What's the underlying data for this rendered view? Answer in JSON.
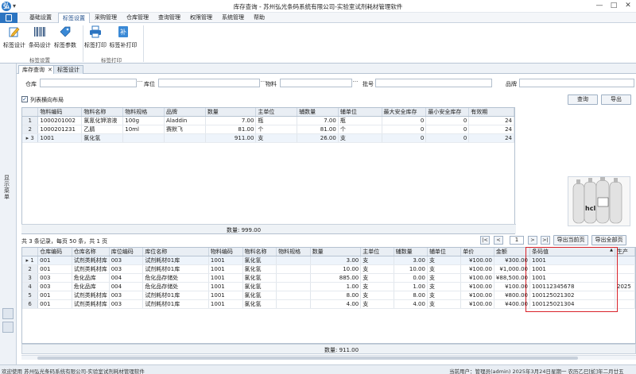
{
  "window": {
    "title": "库存查询 - 苏州弘光条码系统有限公司-实验室试剂耗材管理软件",
    "logo_glyph": "弘",
    "qat_glyph": "▾",
    "min": "—",
    "max": "□",
    "close": "✕"
  },
  "menu": {
    "tabs": [
      {
        "label": "基础设置"
      },
      {
        "label": "标签设置"
      },
      {
        "label": "采购管理"
      },
      {
        "label": "仓库管理"
      },
      {
        "label": "查询管理"
      },
      {
        "label": "权限管理"
      },
      {
        "label": "系统管理"
      },
      {
        "label": "帮助"
      }
    ],
    "active_index": 1
  },
  "ribbon": {
    "groups": [
      {
        "label": "标签设置"
      },
      {
        "label": "标签打印"
      }
    ],
    "buttons": [
      {
        "label": "标签设计",
        "icon": "pencil-edit-icon"
      },
      {
        "label": "条码设计",
        "icon": "barcode-icon"
      },
      {
        "label": "标签参数",
        "icon": "tag-settings-icon"
      },
      {
        "label": "标签打印",
        "icon": "printer-icon"
      },
      {
        "label": "标签补打印",
        "icon": "reprint-icon"
      }
    ]
  },
  "left_panel": {
    "label": "显示菜单"
  },
  "doc_tabs": [
    {
      "label": "库存查询",
      "close": "✕"
    },
    {
      "label": "标签设计"
    }
  ],
  "filters": [
    {
      "label": "仓库",
      "value": ""
    },
    {
      "label": "库位",
      "value": ""
    },
    {
      "label": "物料",
      "value": ""
    },
    {
      "label": "批号",
      "value": ""
    },
    {
      "label": "品牌",
      "value": ""
    }
  ],
  "filter_dots": "···",
  "actions": {
    "checkbox_label": "列表横向布局",
    "checkbox_checked": true,
    "check_mark": "✓",
    "query": "查询",
    "export": "导出"
  },
  "top_grid": {
    "columns": [
      "物料编码",
      "物料名称",
      "物料规格",
      "品牌",
      "数量",
      "主单位",
      "辅数量",
      "辅单位",
      "最大安全库存",
      "最小安全库存",
      "有效期"
    ],
    "current_row_marker": "▸",
    "rows": [
      {
        "idx": "1",
        "cells": [
          "1000201002",
          "氯氰化钾溶液",
          "100g",
          "Aladdin",
          "7.00",
          "瓶",
          "7.00",
          "瓶",
          "0",
          "0",
          "24"
        ]
      },
      {
        "idx": "2",
        "cells": [
          "1000201231",
          "乙腈",
          "10ml",
          "赛默飞",
          "81.00",
          "个",
          "81.00",
          "个",
          "0",
          "0",
          "24"
        ]
      },
      {
        "idx": "3",
        "cells": [
          "1001",
          "氯化氢",
          "",
          "",
          "911.00",
          "支",
          "26.00",
          "支",
          "0",
          "0",
          "24"
        ]
      }
    ],
    "footer": "数量: 999.00"
  },
  "pager": {
    "info": "共 3 条记录，每页 50 条，共 1 页",
    "first": "|<",
    "prev": "<",
    "page": "1",
    "next": ">",
    "last": ">|",
    "export_current": "导出当前页",
    "export_all": "导出全部页"
  },
  "bottom_grid": {
    "columns": [
      "仓库编码",
      "仓库名称",
      "库位编码",
      "库位名称",
      "物料编码",
      "物料名称",
      "物料规格",
      "数量",
      "主单位",
      "辅数量",
      "辅单位",
      "单价",
      "金额",
      "条码值",
      "生产"
    ],
    "sort_marker": "▲",
    "current_row_marker": "▸",
    "rows": [
      {
        "idx": "1",
        "cells": [
          "001",
          "试剂类耗材库",
          "003",
          "试剂耗材01库",
          "1001",
          "氯化氢",
          "",
          "3.00",
          "支",
          "3.00",
          "支",
          "¥100.00",
          "¥300.00",
          "1001",
          ""
        ]
      },
      {
        "idx": "2",
        "cells": [
          "001",
          "试剂类耗材库",
          "003",
          "试剂耗材01库",
          "1001",
          "氯化氢",
          "",
          "10.00",
          "支",
          "10.00",
          "支",
          "¥100.00",
          "¥1,000.00",
          "1001",
          ""
        ]
      },
      {
        "idx": "3",
        "cells": [
          "003",
          "危化品库",
          "004",
          "危化品存储处",
          "1001",
          "氯化氢",
          "",
          "885.00",
          "支",
          "0.00",
          "支",
          "¥100.00",
          "¥88,500.00",
          "1001",
          ""
        ]
      },
      {
        "idx": "4",
        "cells": [
          "003",
          "危化品库",
          "004",
          "危化品存储处",
          "1001",
          "氯化氢",
          "",
          "1.00",
          "支",
          "1.00",
          "支",
          "¥100.00",
          "¥100.00",
          "100112345678",
          "2025"
        ]
      },
      {
        "idx": "5",
        "cells": [
          "001",
          "试剂类耗材库",
          "003",
          "试剂耗材01库",
          "1001",
          "氯化氢",
          "",
          "8.00",
          "支",
          "8.00",
          "支",
          "¥100.00",
          "¥800.00",
          "100125021302",
          ""
        ]
      },
      {
        "idx": "6",
        "cells": [
          "001",
          "试剂类耗材库",
          "003",
          "试剂耗材01库",
          "1001",
          "氯化氢",
          "",
          "4.00",
          "支",
          "4.00",
          "支",
          "¥100.00",
          "¥400.00",
          "100125021304",
          ""
        ]
      }
    ],
    "footer": "数量: 911.00"
  },
  "status": {
    "left": "欢迎使用 苏州弘光条码系统有限公司-实验室试剂耗材管理软件",
    "right": "当前用户：管理员(admin)   2025年3月24日星期一 农历乙巳[蛇]年二月廿五"
  },
  "colors": {
    "accent": "#2b74c1",
    "highlight": "#d9232a",
    "header_bg": "#e9eef4"
  }
}
